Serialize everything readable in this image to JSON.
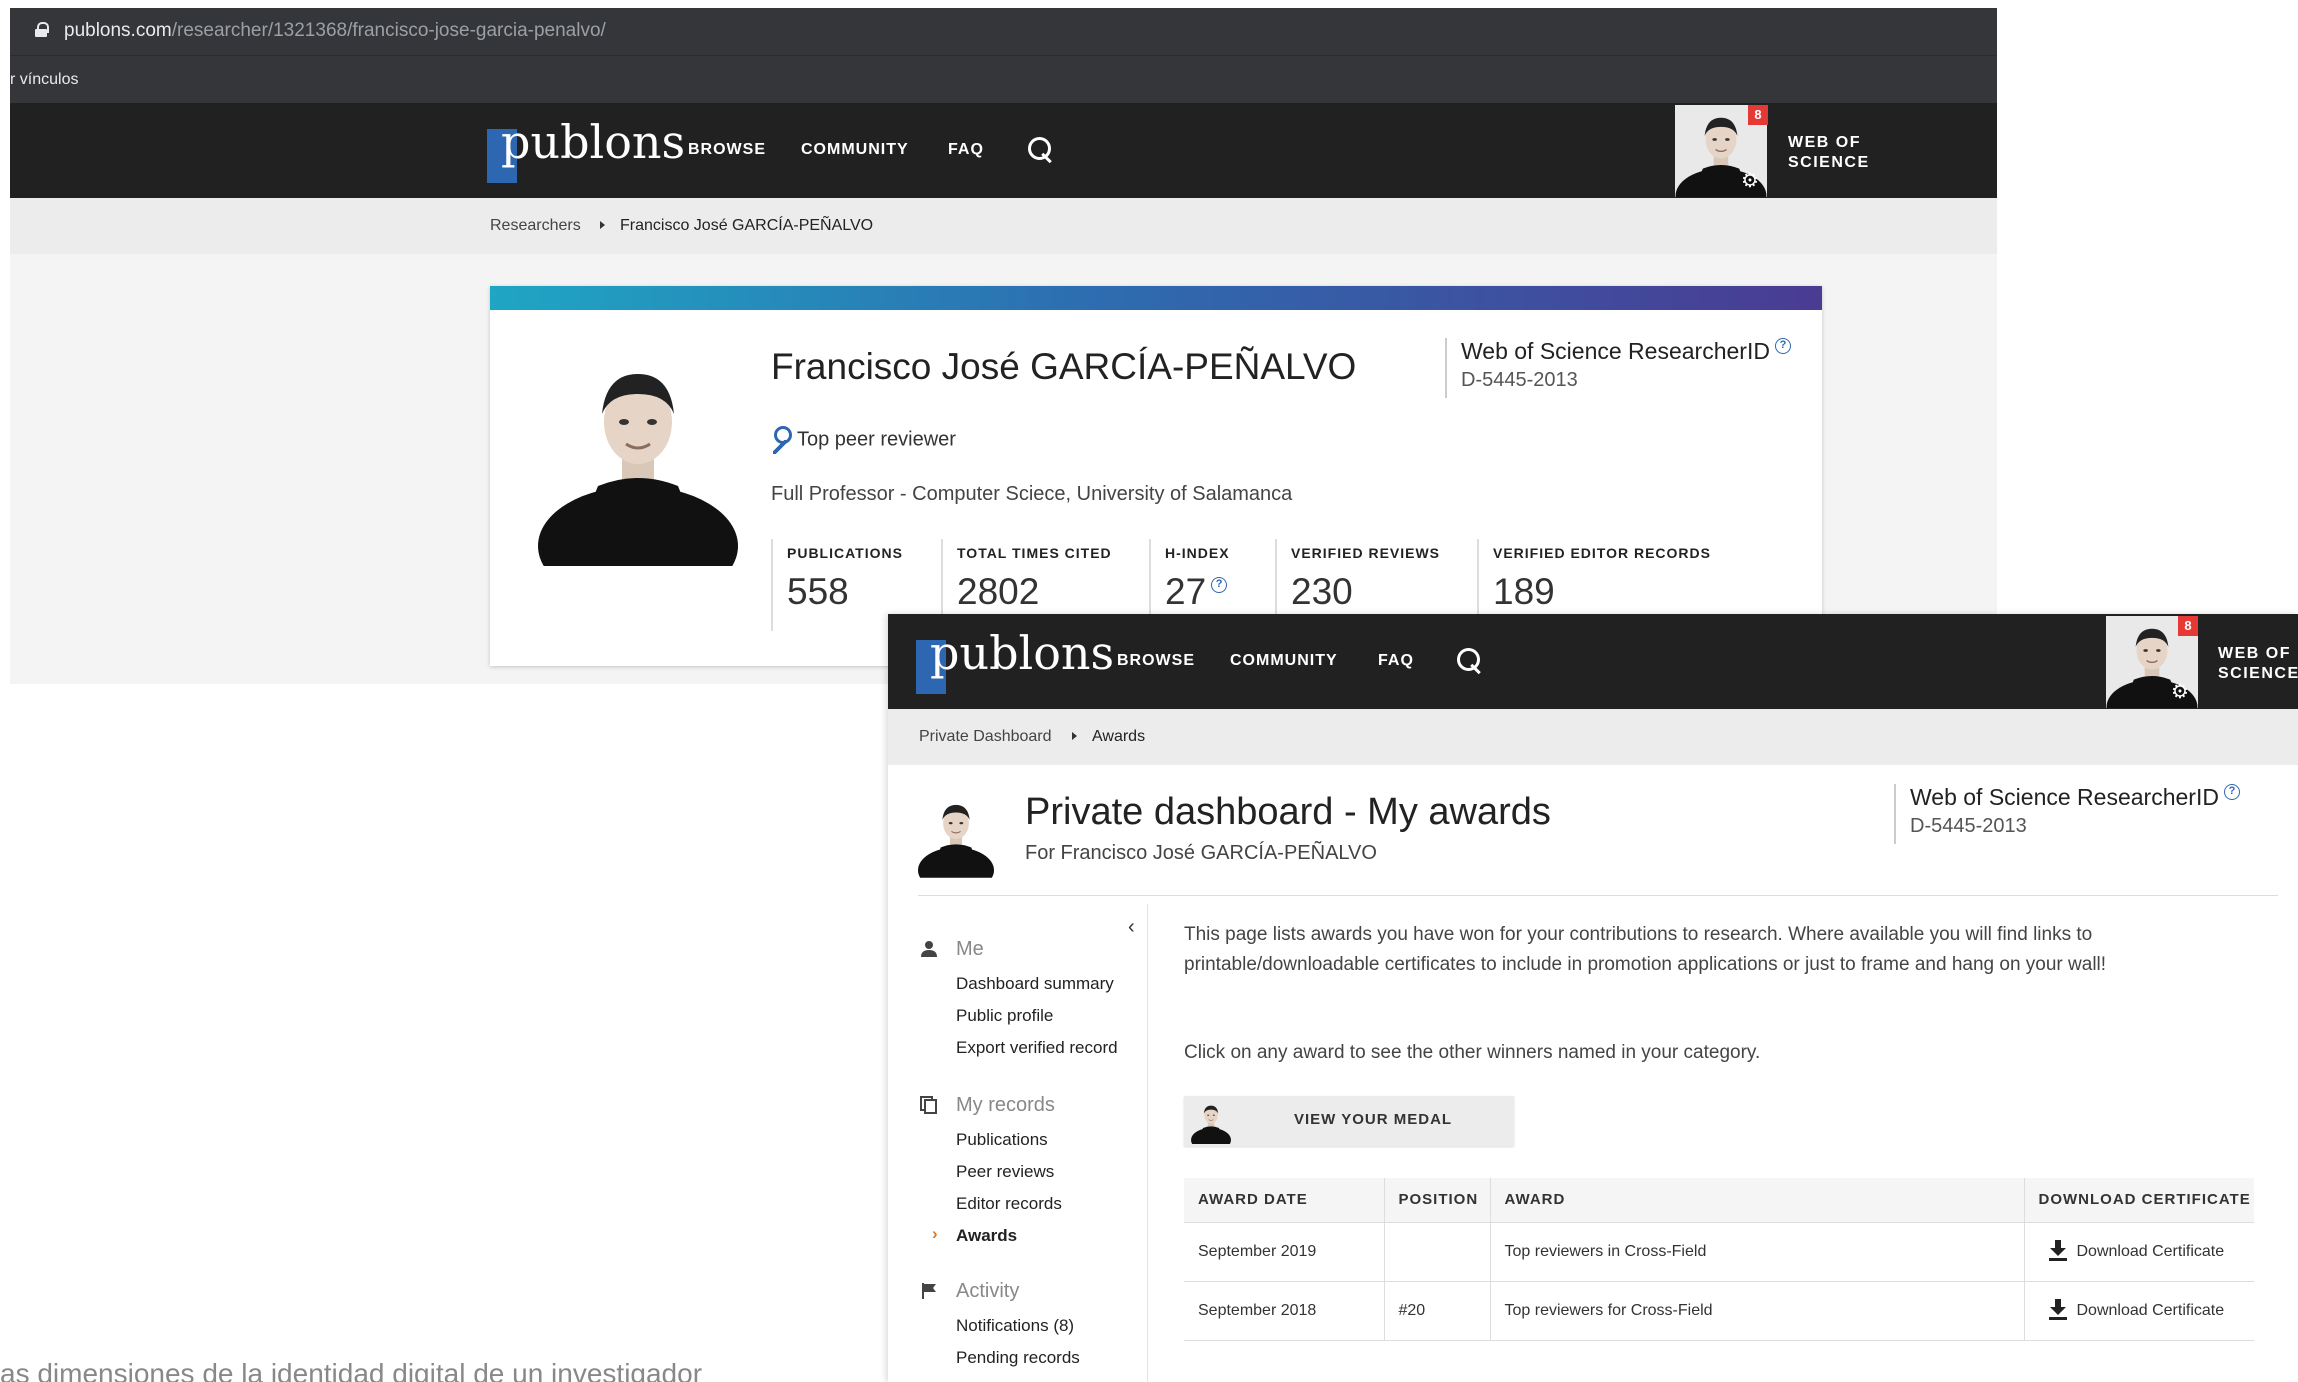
{
  "browser": {
    "url_host": "publons.com",
    "url_path": "/researcher/1321368/francisco-jose-garcia-penalvo/",
    "bookmark_bar": "r vínculos"
  },
  "nav": {
    "logo": "publons",
    "browse": "BROWSE",
    "community": "COMMUNITY",
    "faq": "FAQ",
    "wos_line1": "WEB OF",
    "wos_line2": "SCIENCE",
    "notification_count": "8"
  },
  "profile": {
    "breadcrumb": [
      "Researchers",
      "Francisco José GARCÍA-PEÑALVO"
    ],
    "name": "Francisco José GARCÍA-PEÑALVO",
    "researcher_id_label": "Web of Science ResearcherID",
    "researcher_id": "D-5445-2013",
    "award": "Top peer reviewer",
    "affiliation": "Full Professor - Computer Sciece, University of Salamanca",
    "stats": [
      {
        "label": "PUBLICATIONS",
        "value": "558"
      },
      {
        "label": "TOTAL TIMES CITED",
        "value": "2802"
      },
      {
        "label": "H-INDEX",
        "value": "27"
      },
      {
        "label": "VERIFIED REVIEWS",
        "value": "230"
      },
      {
        "label": "VERIFIED EDITOR RECORDS",
        "value": "189"
      }
    ]
  },
  "dashboard": {
    "breadcrumb": [
      "Private Dashboard",
      "Awards"
    ],
    "title": "Private dashboard - My awards",
    "subtitle": "For Francisco José GARCÍA-PEÑALVO",
    "researcher_id_label": "Web of Science ResearcherID",
    "researcher_id": "D-5445-2013",
    "sidebar": {
      "collapse": "‹",
      "me": "Me",
      "me_items": [
        "Dashboard summary",
        "Public profile",
        "Export verified record"
      ],
      "records": "My records",
      "records_items": [
        "Publications",
        "Peer reviews",
        "Editor records",
        "Awards"
      ],
      "activity": "Activity",
      "activity_items": [
        "Notifications (8)",
        "Pending records"
      ]
    },
    "intro": "This page lists awards you have won for your contributions to research. Where available you will find links to printable/downloadable certificates to include in promotion applications or just to frame and hang on your wall!",
    "click_note": "Click on any award to see the other winners named in your category.",
    "medal_button": "VIEW YOUR MEDAL",
    "table": {
      "headers": [
        "AWARD DATE",
        "POSITION",
        "AWARD",
        "DOWNLOAD CERTIFICATE"
      ],
      "rows": [
        {
          "date": "September 2019",
          "position": "",
          "award": "Top reviewers in Cross-Field",
          "download": "Download Certificate"
        },
        {
          "date": "September 2018",
          "position": "#20",
          "award": "Top reviewers for Cross-Field",
          "download": "Download Certificate"
        }
      ]
    }
  },
  "caption": "as dimensiones de la identidad digital de un investigador",
  "colors": {
    "nav_bg": "#212121",
    "logo_blue": "#2e67b1",
    "badge_red": "#e53935",
    "active_arrow": "#e07a1f"
  }
}
